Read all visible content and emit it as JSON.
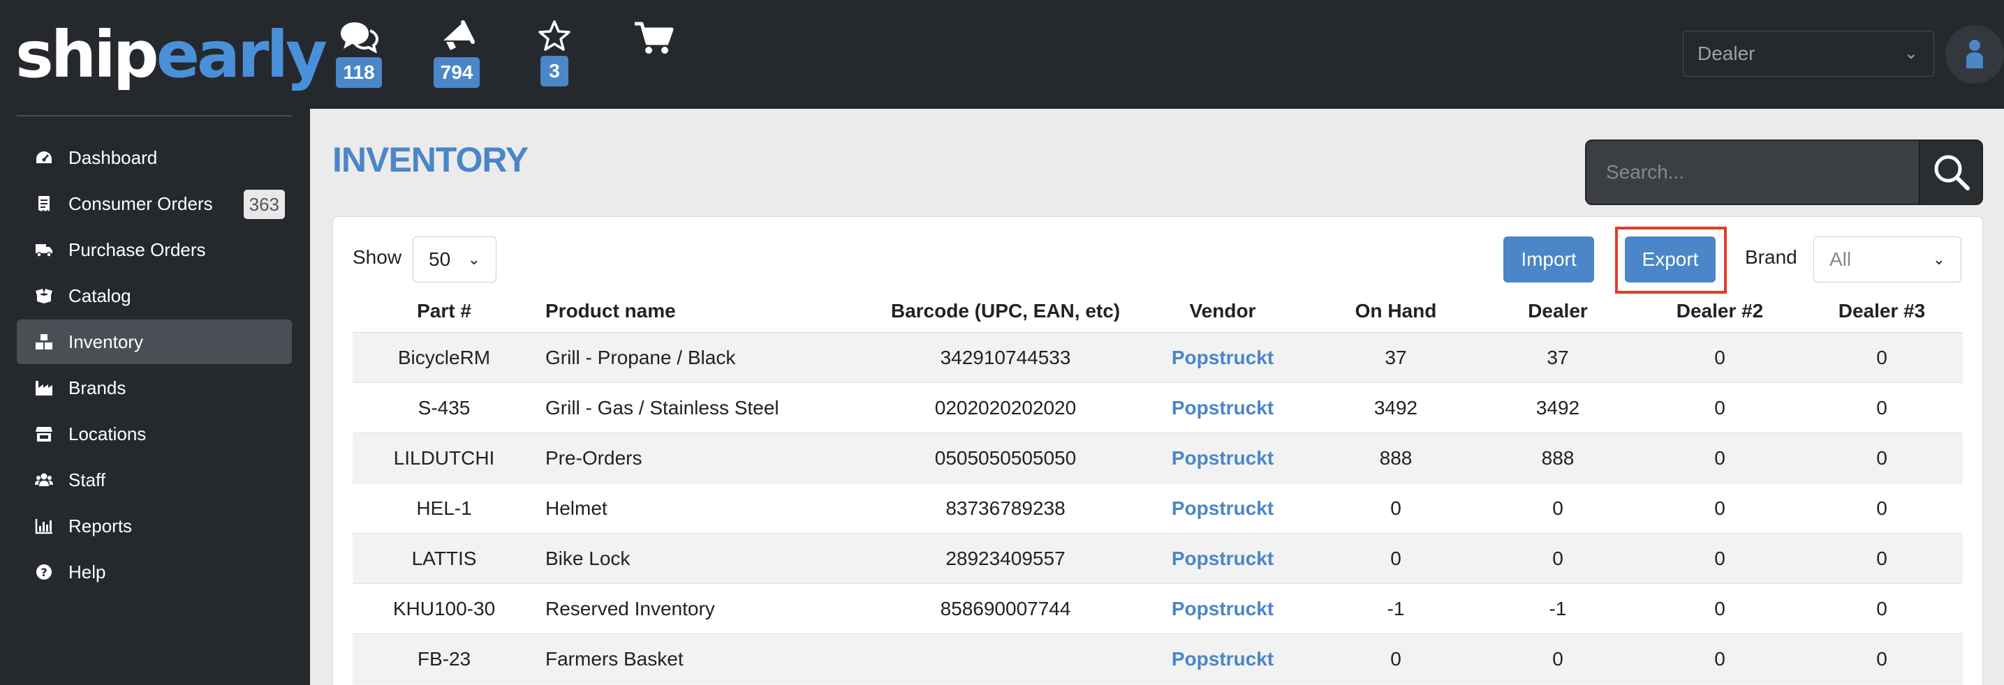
{
  "header": {
    "logo_part1": "ship",
    "logo_part2": "early",
    "notifications": [
      {
        "icon": "chat-bubbles-icon",
        "count": "118"
      },
      {
        "icon": "megaphone-icon",
        "count": "794"
      },
      {
        "icon": "star-outline-icon",
        "count": "3"
      },
      {
        "icon": "cart-icon",
        "count": ""
      }
    ],
    "role_select": {
      "value": "Dealer"
    },
    "avatar_icon": "user-icon"
  },
  "sidebar": {
    "items": [
      {
        "label": "Dashboard",
        "icon": "tachometer-icon",
        "active": false,
        "badge": ""
      },
      {
        "label": "Consumer Orders",
        "icon": "receipt-icon",
        "active": false,
        "badge": "363"
      },
      {
        "label": "Purchase Orders",
        "icon": "truck-icon",
        "active": false,
        "badge": ""
      },
      {
        "label": "Catalog",
        "icon": "box-open-icon",
        "active": false,
        "badge": ""
      },
      {
        "label": "Inventory",
        "icon": "boxes-icon",
        "active": true,
        "badge": ""
      },
      {
        "label": "Brands",
        "icon": "industry-icon",
        "active": false,
        "badge": ""
      },
      {
        "label": "Locations",
        "icon": "store-icon",
        "active": false,
        "badge": ""
      },
      {
        "label": "Staff",
        "icon": "users-icon",
        "active": false,
        "badge": ""
      },
      {
        "label": "Reports",
        "icon": "chart-bar-icon",
        "active": false,
        "badge": ""
      },
      {
        "label": "Help",
        "icon": "question-circle-icon",
        "active": false,
        "badge": ""
      }
    ]
  },
  "main": {
    "title": "INVENTORY",
    "search": {
      "placeholder": "Search...",
      "value": ""
    },
    "toolbar": {
      "show_label": "Show",
      "show_value": "50",
      "import_label": "Import",
      "export_label": "Export",
      "brand_label": "Brand",
      "brand_value": "All"
    },
    "table": {
      "headers": [
        "Part #",
        "Product name",
        "Barcode (UPC, EAN, etc)",
        "Vendor",
        "On Hand",
        "Dealer",
        "Dealer #2",
        "Dealer #3"
      ],
      "rows": [
        [
          "BicycleRM",
          "Grill - Propane / Black",
          "342910744533",
          "Popstruckt",
          "37",
          "37",
          "0",
          "0"
        ],
        [
          "S-435",
          "Grill - Gas / Stainless Steel",
          "0202020202020",
          "Popstruckt",
          "3492",
          "3492",
          "0",
          "0"
        ],
        [
          "LILDUTCHI",
          "Pre-Orders",
          "0505050505050",
          "Popstruckt",
          "888",
          "888",
          "0",
          "0"
        ],
        [
          "HEL-1",
          "Helmet",
          "83736789238",
          "Popstruckt",
          "0",
          "0",
          "0",
          "0"
        ],
        [
          "LATTIS",
          "Bike Lock",
          "28923409557",
          "Popstruckt",
          "0",
          "0",
          "0",
          "0"
        ],
        [
          "KHU100-30",
          "Reserved Inventory",
          "858690007744",
          "Popstruckt",
          "-1",
          "-1",
          "0",
          "0"
        ],
        [
          "FB-23",
          "Farmers Basket",
          "",
          "Popstruckt",
          "0",
          "0",
          "0",
          "0"
        ]
      ]
    }
  },
  "colors": {
    "accent": "#4a86c8",
    "topbar": "#25292e",
    "highlight": "#e03c28"
  }
}
